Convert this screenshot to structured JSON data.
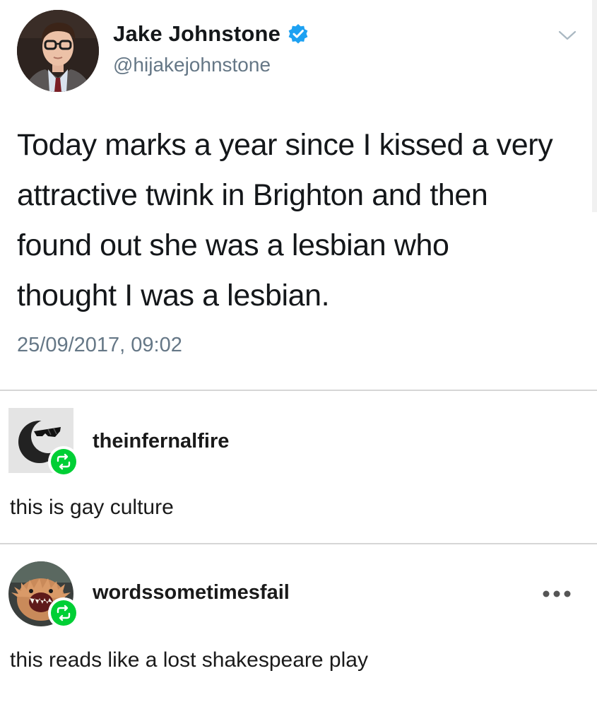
{
  "tweet": {
    "display_name": "Jake Johnstone",
    "handle": "@hijakejohnstone",
    "text_lines": [
      "Today marks a year since I kissed a very",
      "attractive twink in Brighton and then",
      "found out she was a lesbian who",
      "thought I was a lesbian."
    ],
    "timestamp": "25/09/2017, 09:02",
    "verified_color": "#1da1f2",
    "handle_color": "#657786"
  },
  "reblogs": [
    {
      "username": "theinfernalfire",
      "comment": "this is gay culture",
      "avatar_icon": "sunglasses-moon-icon",
      "badge_icon": "reblog-icon"
    },
    {
      "username": "wordssometimesfail",
      "comment": "this reads like a lost shakespeare play",
      "avatar_icon": "creature-photo",
      "badge_icon": "reblog-icon",
      "menu_icon": "more-options-icon"
    }
  ],
  "colors": {
    "reblog_green": "#00cf35",
    "divider": "#d6d6d6",
    "text": "#14171a"
  }
}
